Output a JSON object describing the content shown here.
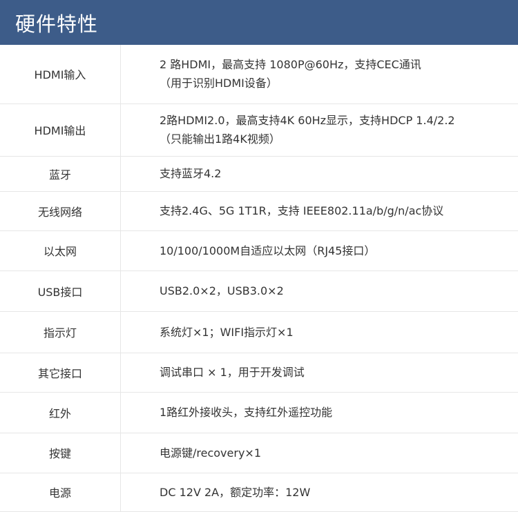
{
  "header": {
    "title": "硬件特性"
  },
  "rows": [
    {
      "label": "HDMI输入",
      "lines": [
        "2 路HDMI，最高支持 1080P@60Hz，支持CEC通讯",
        "（用于识别HDMI设备）"
      ]
    },
    {
      "label": "HDMI输出",
      "lines": [
        "2路HDMI2.0，最高支持4K 60Hz显示，支持HDCP 1.4/2.2",
        "（只能输出1路4K视频）"
      ]
    },
    {
      "label": "蓝牙",
      "lines": [
        "支持蓝牙4.2"
      ]
    },
    {
      "label": "无线网络",
      "lines": [
        "支持2.4G、5G 1T1R，支持 IEEE802.11a/b/g/n/ac协议"
      ]
    },
    {
      "label": "以太网",
      "lines": [
        "10/100/1000M自适应以太网（RJ45接口）"
      ]
    },
    {
      "label": "USB接口",
      "lines": [
        "USB2.0×2，USB3.0×2"
      ]
    },
    {
      "label": "指示灯",
      "lines": [
        "系统灯×1；WIFI指示灯×1"
      ]
    },
    {
      "label": "其它接口",
      "lines": [
        "调试串口 × 1，用于开发调试"
      ]
    },
    {
      "label": "红外",
      "lines": [
        "1路红外接收头，支持红外遥控功能"
      ]
    },
    {
      "label": "按键",
      "lines": [
        "电源键/recovery×1"
      ]
    },
    {
      "label": "电源",
      "lines": [
        "DC 12V 2A，额定功率：12W"
      ]
    }
  ]
}
